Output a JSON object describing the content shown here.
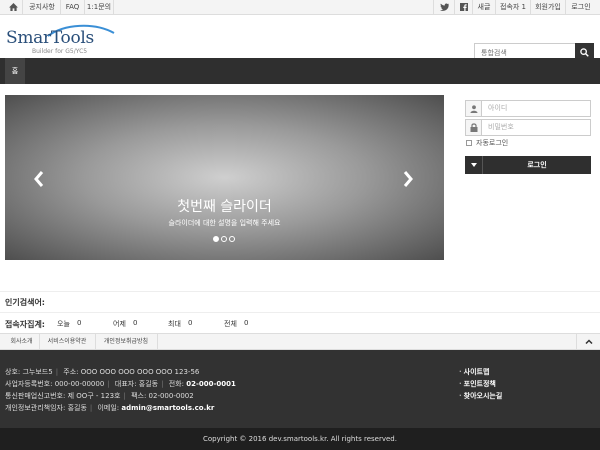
{
  "topbar": {
    "left": [
      "공지사항",
      "FAQ",
      "1:1문의"
    ],
    "right": [
      "새글",
      "접속자 1",
      "회원가입",
      "로그인"
    ]
  },
  "header": {
    "logo_text": "SmarTools",
    "logo_sub": "Builder for G5/YC5",
    "search_placeholder": "통합검색"
  },
  "nav": {
    "home": "홈"
  },
  "slider": {
    "title": "첫번째 슬라이더",
    "description": "슬라이더에 대한 설명을 입력해 주세요",
    "slides": 3,
    "active_slide": 1
  },
  "login": {
    "id_placeholder": "아이디",
    "pw_placeholder": "비밀번호",
    "auto_login": "자동로그인",
    "button": "로그인"
  },
  "popular": {
    "label": "인기검색어:"
  },
  "stats": {
    "label": "접속자집계:",
    "items": [
      {
        "name": "오늘",
        "value": "0"
      },
      {
        "name": "어제",
        "value": "0"
      },
      {
        "name": "최대",
        "value": "0"
      },
      {
        "name": "전체",
        "value": "0"
      }
    ]
  },
  "footer_nav": [
    "회사소개",
    "서비스이용약관",
    "개인정보취급방침"
  ],
  "footer": {
    "line1": {
      "label1": "상호:",
      "v1": "그누보드5",
      "label2": "주소:",
      "v2": "OOO OOO OOO OOO OOO 123-56"
    },
    "line2": {
      "label1": "사업자등록번호:",
      "v1": "000-00-00000",
      "label2": "대표자:",
      "v2": "홍길동",
      "label3": "전화:",
      "v3": "02-000-0001"
    },
    "line3": {
      "label1": "통신판매업신고번호:",
      "v1": "제 OO구 - 123호",
      "label2": "팩스:",
      "v2": "02-000-0002"
    },
    "line4": {
      "label1": "개인정보관리책임자:",
      "v1": "홍길동",
      "label2": "이메일:",
      "v2": "admin@smartools.co.kr"
    },
    "links": [
      "사이트맵",
      "포인트정책",
      "찾아오시는길"
    ]
  },
  "copyright": "Copyright © 2016 dev.smartools.kr. All rights reserved."
}
